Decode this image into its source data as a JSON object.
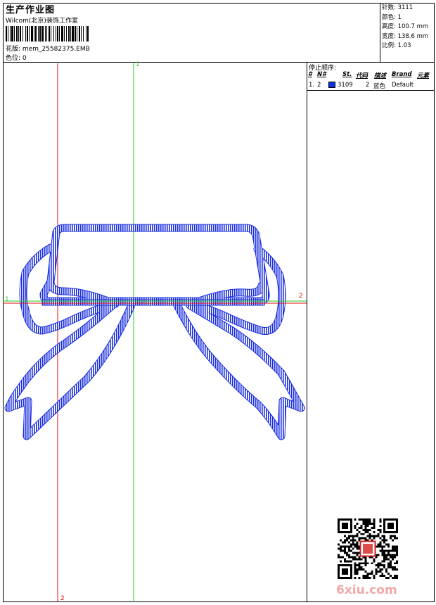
{
  "header": {
    "title": "生产作业图",
    "company": "Wilcom(北京)装饰工作室",
    "design_file_label": "花版:",
    "design_file": "mem_25582375.EMB",
    "color_pos_label": "色位:",
    "color_pos": "0"
  },
  "stats": {
    "stitches_label": "针数:",
    "stitches": "3111",
    "colors_label": "颜色:",
    "colors": "1",
    "height_label": "高度:",
    "height": "100.7 mm",
    "width_label": "宽度:",
    "width": "138.6 mm",
    "scale_label": "比例:",
    "scale": "1.03"
  },
  "stop_sequence": {
    "title": "停止顺序:",
    "headers": [
      "#",
      "N#",
      "St.",
      "代码",
      "描述",
      "Brand",
      "元素"
    ],
    "rows": [
      {
        "num": "1.",
        "needle": "2",
        "code": "3109",
        "stitches": "2",
        "desc": "蓝色",
        "brand": "Default",
        "color": "#0a32e6"
      }
    ]
  },
  "axes": {
    "v_green_top": "1",
    "h_green_left": "1",
    "h_red_right": "2",
    "v_red_bottom": "2"
  },
  "watermark": "6xiu.com",
  "colors": {
    "thread": "#1a2ee0",
    "green_axis": "#22cc22",
    "red_axis": "#e01010"
  }
}
